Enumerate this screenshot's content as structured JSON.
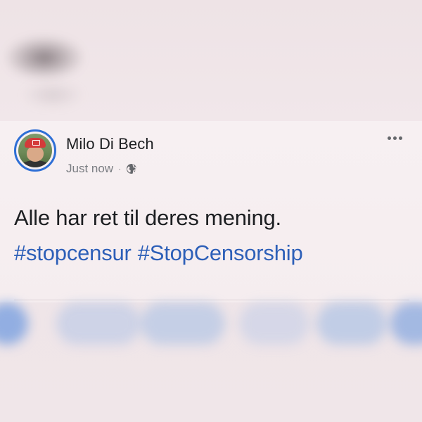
{
  "post": {
    "author": "Milo Di Bech",
    "timestamp": "Just now",
    "separator": "·",
    "privacy_icon": "globe-icon",
    "more_icon": "more-options-icon",
    "text": "Alle har ret til deres mening.",
    "hashtags": [
      "#stopcensur",
      "#StopCensorship"
    ]
  },
  "colors": {
    "accent": "#2e6fd6",
    "hashtag": "#2d5fb8",
    "text": "#1c1e21",
    "muted": "#7a7d82"
  }
}
